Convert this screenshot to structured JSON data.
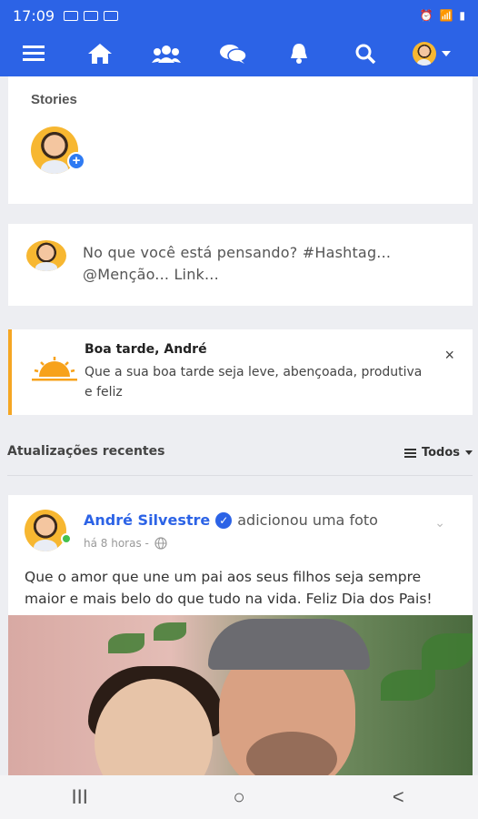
{
  "statusbar": {
    "time": "17:09"
  },
  "colors": {
    "brand": "#2c63e6",
    "accent": "#f5a623",
    "online": "#44c04d"
  },
  "nav": {
    "items": [
      "menu-icon",
      "home-icon",
      "groups-icon",
      "chat-icon",
      "bell-icon",
      "search-icon",
      "profile-avatar"
    ]
  },
  "stories": {
    "title": "Stories"
  },
  "composer": {
    "placeholder": "No que você está pensando? #Hashtag... @Menção... Link..."
  },
  "greeting": {
    "title": "Boa tarde, André",
    "text": "Que a sua boa tarde seja leve, abençoada, produtiva e feliz",
    "close": "×"
  },
  "updates": {
    "title": "Atualizações recentes",
    "filter": "Todos"
  },
  "post": {
    "author": "André Silvestre",
    "action": "adicionou uma foto",
    "time": "há 8 horas -",
    "text": "Que o amor que une um pai aos seus filhos seja sempre maior e mais belo do que tudo na vida. Feliz Dia dos Pais!"
  },
  "bottom_nav": {
    "recent": "III",
    "home": "○",
    "back": "<"
  }
}
